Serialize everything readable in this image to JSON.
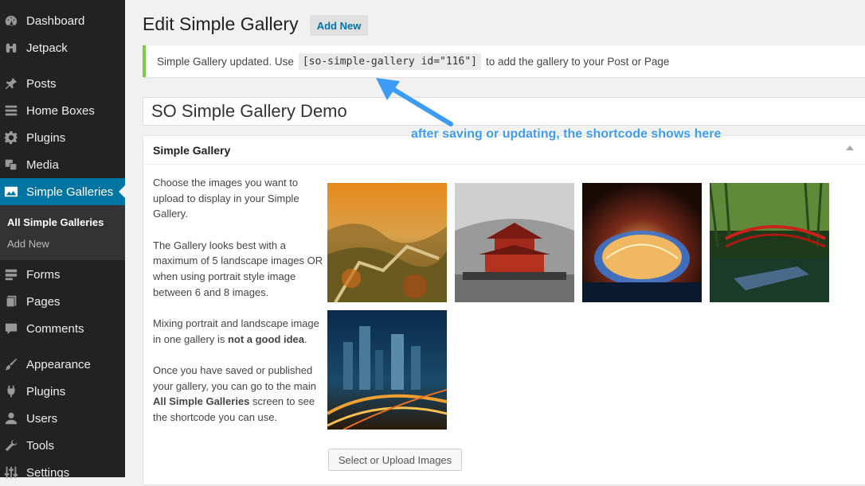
{
  "sidebar": {
    "items": [
      {
        "label": "Dashboard",
        "icon": "dashboard-icon"
      },
      {
        "label": "Jetpack",
        "icon": "jetpack-icon"
      },
      {
        "label": "Posts",
        "icon": "pin-icon"
      },
      {
        "label": "Home Boxes",
        "icon": "list-icon"
      },
      {
        "label": "Plugins",
        "icon": "gear-icon"
      },
      {
        "label": "Media",
        "icon": "media-icon"
      },
      {
        "label": "Simple Galleries",
        "icon": "gallery-icon",
        "active": true
      },
      {
        "label": "Forms",
        "icon": "form-icon"
      },
      {
        "label": "Pages",
        "icon": "pages-icon"
      },
      {
        "label": "Comments",
        "icon": "comment-icon"
      },
      {
        "label": "Appearance",
        "icon": "brush-icon"
      },
      {
        "label": "Plugins",
        "icon": "plug-icon"
      },
      {
        "label": "Users",
        "icon": "user-icon"
      },
      {
        "label": "Tools",
        "icon": "wrench-icon"
      },
      {
        "label": "Settings",
        "icon": "settings-icon"
      }
    ],
    "submenu": {
      "current": "All Simple Galleries",
      "other": "Add New"
    }
  },
  "header": {
    "title": "Edit Simple Gallery",
    "add_new": "Add New"
  },
  "notice": {
    "text_before": "Simple Gallery updated. Use",
    "shortcode": "[so-simple-gallery id=\"116\"]",
    "text_after": "to add the gallery to your Post or Page"
  },
  "post_title": "SO Simple Gallery Demo",
  "annotation": "after saving or updating, the shortcode shows here",
  "metabox": {
    "title": "Simple Gallery",
    "p1": "Choose the images you want to upload to display in your Simple Gallery.",
    "p2": "The Gallery looks best with a maximum of 5 landscape images OR when using portrait style image between 6 and 8 images.",
    "p3_before": "Mixing portrait and landscape image in one gallery is",
    "p3_bold": "not a good idea",
    "p3_after": ".",
    "p4_before": "Once you have saved or published your gallery, you can go to the main",
    "p4_bold": "All Simple Galleries",
    "p4_after": "screen to see the shortcode you can use.",
    "upload_button": "Select or Upload Images"
  },
  "colors": {
    "sidebar_bg": "#222222",
    "active_bg": "#0074a2",
    "notice_border": "#7ad03a",
    "annotation": "#3b9bf5"
  }
}
